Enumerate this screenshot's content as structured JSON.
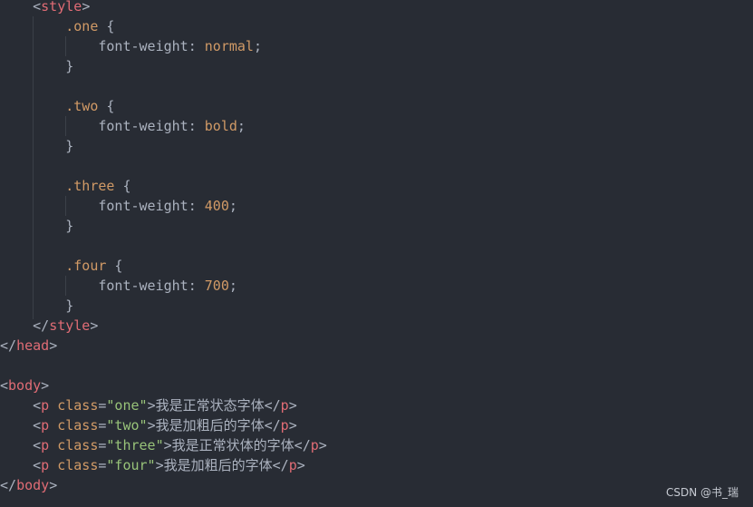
{
  "style_block": {
    "open_tag": "style",
    "close_tag": "style",
    "rules": [
      {
        "selector": ".one",
        "property": "font-weight",
        "value": "normal"
      },
      {
        "selector": ".two",
        "property": "font-weight",
        "value": "bold"
      },
      {
        "selector": ".three",
        "property": "font-weight",
        "value": "400"
      },
      {
        "selector": ".four",
        "property": "font-weight",
        "value": "700"
      }
    ]
  },
  "head_close": "head",
  "body_block": {
    "tag": "body",
    "paragraphs": [
      {
        "tag": "p",
        "attr": "class",
        "attr_value": "\"one\"",
        "text": "我是正常状态字体"
      },
      {
        "tag": "p",
        "attr": "class",
        "attr_value": "\"two\"",
        "text": "我是加粗后的字体"
      },
      {
        "tag": "p",
        "attr": "class",
        "attr_value": "\"three\"",
        "text": "我是正常状体的字体"
      },
      {
        "tag": "p",
        "attr": "class",
        "attr_value": "\"four\"",
        "text": "我是加粗后的字体"
      }
    ]
  },
  "watermark": "CSDN @书_瑞",
  "colors": {
    "background": "#282c34",
    "tag": "#e06c75",
    "attribute": "#d19a66",
    "string": "#98c379",
    "text": "#abb2bf"
  }
}
